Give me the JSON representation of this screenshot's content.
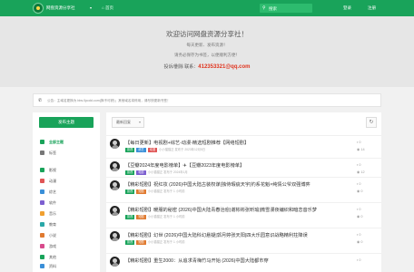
{
  "header": {
    "site_name": "网盘资源分享社",
    "caret": "▾",
    "home_label": "首页",
    "search_placeholder": "搜索",
    "login_label": "登录",
    "register_label": "注册",
    "icons": {
      "logo": "site-logo-icon",
      "home": "home-icon",
      "search": "search-icon"
    }
  },
  "hero": {
    "title": "欢迎访问网盘资源分享社！",
    "line1": "每天更新、发布资源！",
    "line2": "请务必保存为书签，以便顺利方便！",
    "contact_prefix": "投诉/删除 联系：",
    "contact_email": "412353321@qq.com"
  },
  "notice": {
    "icon": "megaphone-icon",
    "text": "公告：主域名更换为 bbs.0pcdd.com(换不可获)；其他域名将停用，请尽快更新书签！"
  },
  "sidebar": {
    "new_topic_label": "发布主题",
    "items": [
      {
        "label": "全部主题",
        "color": "#19a35a",
        "active": true,
        "icon": "chat-bubbles-icon"
      },
      {
        "label": "标签",
        "color": "#777777",
        "active": false,
        "icon": "tags-icon"
      },
      {
        "label": "影视",
        "color": "#19a35a",
        "active": false,
        "icon": "film-icon"
      },
      {
        "label": "动漫",
        "color": "#e05555",
        "active": false,
        "icon": "anime-icon"
      },
      {
        "label": "综艺",
        "color": "#3a8fd8",
        "active": false,
        "icon": "tv-icon"
      },
      {
        "label": "软件",
        "color": "#7d5fd0",
        "active": false,
        "icon": "software-icon"
      },
      {
        "label": "音乐",
        "color": "#f0a030",
        "active": false,
        "icon": "music-icon"
      },
      {
        "label": "教育",
        "color": "#2aa8a8",
        "active": false,
        "icon": "education-icon"
      },
      {
        "label": "小说",
        "color": "#e07a30",
        "active": false,
        "icon": "book-icon"
      },
      {
        "label": "游戏",
        "color": "#d84a8c",
        "active": false,
        "icon": "game-icon"
      },
      {
        "label": "其他",
        "color": "#19a35a",
        "active": false,
        "icon": "other-icon"
      },
      {
        "label": "资料",
        "color": "#3a8fd8",
        "active": false,
        "icon": "document-icon"
      },
      {
        "label": "其他",
        "color": "#999999",
        "active": false,
        "icon": "more-icon"
      }
    ]
  },
  "content": {
    "sort_label": "最新回复",
    "sort_caret": "▾",
    "refresh_icon": "refresh-icon",
    "topics": [
      {
        "title": "【每日更新】电视剧+综艺-动漫-精选短剧推荐【网络短剧】",
        "tags": [
          {
            "label": "影视",
            "color": "#19a35a"
          },
          {
            "label": "综艺",
            "color": "#3a8fd8"
          },
          {
            "label": "动漫",
            "color": "#e05555"
          }
        ],
        "meta": "小小猫猫正 发布于 2023年12月5日",
        "replies": "0",
        "views": "14"
      },
      {
        "title": "【豆瓣2024年度电影榜单】✈【豆瓣2023年度电影榜单】",
        "tags": [
          {
            "label": "影视",
            "color": "#19a35a"
          },
          {
            "label": "电影",
            "color": "#7d5fd0"
          }
        ],
        "meta": "小小猫猫正 发布于 2024年1月",
        "replies": "0",
        "views": "12"
      },
      {
        "title": "【精彩短剧】祝红妆 (2026)中国大陆古装权谋|独侍瑕疵天宇|钓系花魁×纯情公爷双强博弈",
        "tags": [
          {
            "label": "影视",
            "color": "#19a35a"
          },
          {
            "label": "短剧",
            "color": "#e07a30"
          }
        ],
        "meta": "小小猫猫正 发布于 1 小时前",
        "replies": "0",
        "views": "0"
      },
      {
        "title": "【精彩短剧】暖服的秘密 (2026)中国大陆青春治愈|谢彬彬张昕瑜|微雪漫夜编织和暗恋音乐梦",
        "tags": [
          {
            "label": "影视",
            "color": "#19a35a"
          },
          {
            "label": "短剧",
            "color": "#e07a30"
          }
        ],
        "meta": "小小猫猫正 发布于 1 小时前",
        "replies": "0",
        "views": "0"
      },
      {
        "title": "【精彩短剧】幻世 (2026)中国大陆科幻悬疑|郭月婷张天阳|四大乐园意识战略精利拄降误",
        "tags": [
          {
            "label": "影视",
            "color": "#19a35a"
          },
          {
            "label": "短剧",
            "color": "#e07a30"
          }
        ],
        "meta": "小小猫猫正 发布于 1 小时前",
        "replies": "0",
        "views": "0"
      },
      {
        "title": "【精彩短剧】重生2000：从追求青梅竹马开始 (2026)中国大陆都市穿",
        "tags": [],
        "meta": "",
        "replies": "0",
        "views": ""
      }
    ]
  }
}
